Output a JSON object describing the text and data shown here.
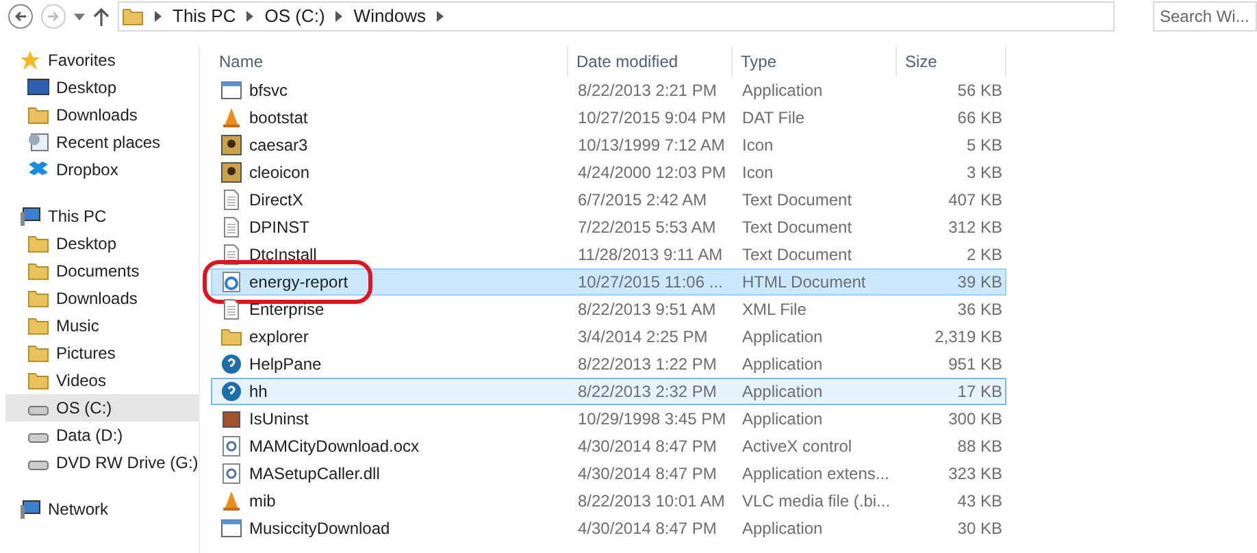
{
  "address_bar": {
    "crumbs": [
      "This PC",
      "OS (C:)",
      "Windows"
    ]
  },
  "search": {
    "placeholder": "Search Wi..."
  },
  "sidebar": {
    "groups": [
      {
        "label": "Favorites",
        "items": [
          {
            "label": "Desktop",
            "selected": false
          },
          {
            "label": "Downloads",
            "selected": false
          },
          {
            "label": "Recent places",
            "selected": false
          },
          {
            "label": "Dropbox",
            "selected": false
          }
        ]
      },
      {
        "label": "This PC",
        "items": [
          {
            "label": "Desktop",
            "selected": false
          },
          {
            "label": "Documents",
            "selected": false
          },
          {
            "label": "Downloads",
            "selected": false
          },
          {
            "label": "Music",
            "selected": false
          },
          {
            "label": "Pictures",
            "selected": false
          },
          {
            "label": "Videos",
            "selected": false
          },
          {
            "label": "OS (C:)",
            "selected": true
          },
          {
            "label": "Data (D:)",
            "selected": false
          },
          {
            "label": "DVD RW Drive (G:)",
            "selected": false
          }
        ]
      },
      {
        "label": "Network"
      }
    ]
  },
  "table": {
    "columns": [
      "Name",
      "Date modified",
      "Type",
      "Size"
    ],
    "rows": [
      {
        "name": "bfsvc",
        "date": "8/22/2013 2:21 PM",
        "type": "Application",
        "size": "56 KB",
        "selected": false,
        "hovered": false,
        "circled": false
      },
      {
        "name": "bootstat",
        "date": "10/27/2015 9:04 PM",
        "type": "DAT File",
        "size": "66 KB",
        "selected": false,
        "hovered": false,
        "circled": false
      },
      {
        "name": "caesar3",
        "date": "10/13/1999 7:12 AM",
        "type": "Icon",
        "size": "5 KB",
        "selected": false,
        "hovered": false,
        "circled": false
      },
      {
        "name": "cleoicon",
        "date": "4/24/2000 12:03 PM",
        "type": "Icon",
        "size": "3 KB",
        "selected": false,
        "hovered": false,
        "circled": false
      },
      {
        "name": "DirectX",
        "date": "6/7/2015 2:42 AM",
        "type": "Text Document",
        "size": "407 KB",
        "selected": false,
        "hovered": false,
        "circled": false
      },
      {
        "name": "DPINST",
        "date": "7/22/2015 5:53 AM",
        "type": "Text Document",
        "size": "312 KB",
        "selected": false,
        "hovered": false,
        "circled": false
      },
      {
        "name": "DtcInstall",
        "date": "11/28/2013 9:11 AM",
        "type": "Text Document",
        "size": "2 KB",
        "selected": false,
        "hovered": false,
        "circled": false
      },
      {
        "name": "energy-report",
        "date": "10/27/2015 11:06 ...",
        "type": "HTML Document",
        "size": "39 KB",
        "selected": true,
        "hovered": false,
        "circled": true
      },
      {
        "name": "Enterprise",
        "date": "8/22/2013 9:51 AM",
        "type": "XML File",
        "size": "36 KB",
        "selected": false,
        "hovered": false,
        "circled": false
      },
      {
        "name": "explorer",
        "date": "3/4/2014 2:25 PM",
        "type": "Application",
        "size": "2,319 KB",
        "selected": false,
        "hovered": false,
        "circled": false
      },
      {
        "name": "HelpPane",
        "date": "8/22/2013 1:22 PM",
        "type": "Application",
        "size": "951 KB",
        "selected": false,
        "hovered": false,
        "circled": false
      },
      {
        "name": "hh",
        "date": "8/22/2013 2:32 PM",
        "type": "Application",
        "size": "17 KB",
        "selected": false,
        "hovered": true,
        "circled": false
      },
      {
        "name": "IsUninst",
        "date": "10/29/1998 3:45 PM",
        "type": "Application",
        "size": "300 KB",
        "selected": false,
        "hovered": false,
        "circled": false
      },
      {
        "name": "MAMCityDownload.ocx",
        "date": "4/30/2014 8:47 PM",
        "type": "ActiveX control",
        "size": "88 KB",
        "selected": false,
        "hovered": false,
        "circled": false
      },
      {
        "name": "MASetupCaller.dll",
        "date": "4/30/2014 8:47 PM",
        "type": "Application extens...",
        "size": "323 KB",
        "selected": false,
        "hovered": false,
        "circled": false
      },
      {
        "name": "mib",
        "date": "8/22/2013 10:01 AM",
        "type": "VLC media file (.bi...",
        "size": "43 KB",
        "selected": false,
        "hovered": false,
        "circled": false
      },
      {
        "name": "MusiccityDownload",
        "date": "4/30/2014 8:47 PM",
        "type": "Application",
        "size": "30 KB",
        "selected": false,
        "hovered": false,
        "circled": false
      }
    ]
  }
}
